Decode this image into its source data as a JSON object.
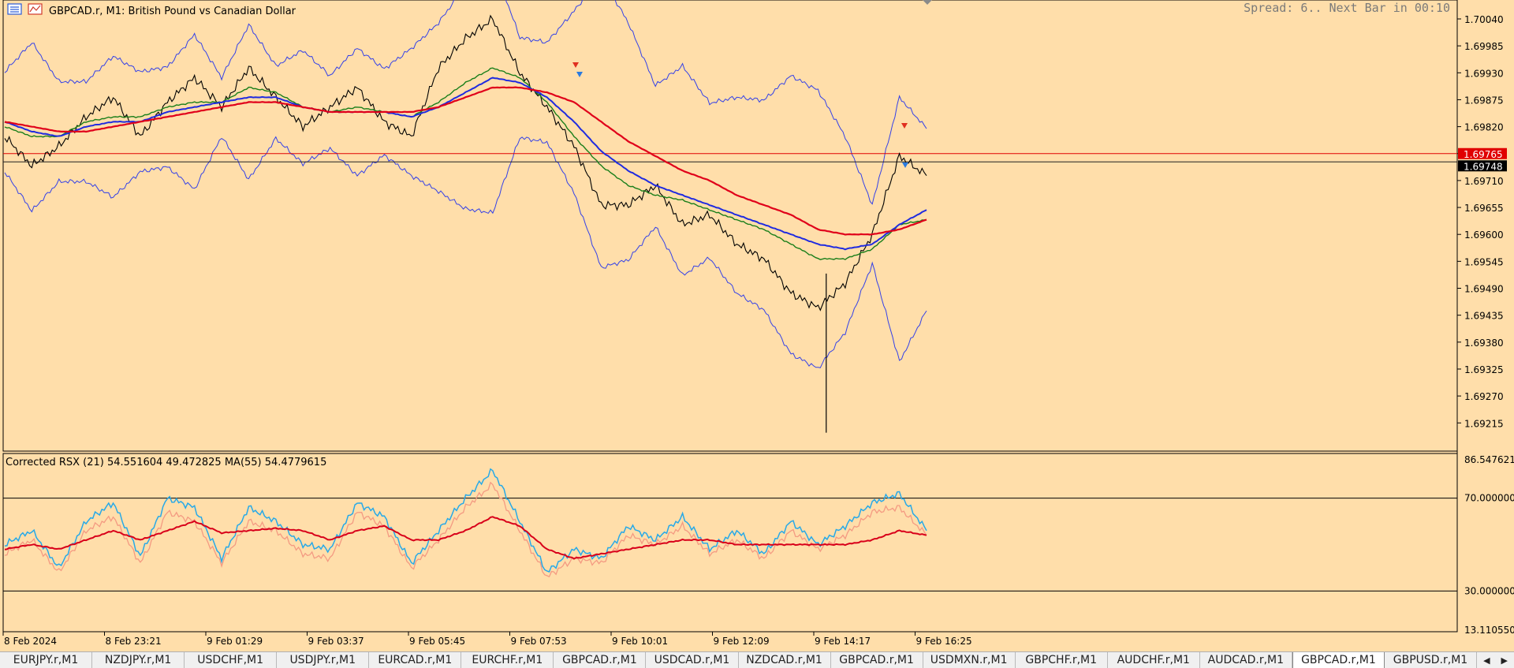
{
  "window": {
    "symbol_title": "GBPCAD.r, M1:  British Pound vs Canadian Dollar",
    "spread_info": "Spread: 6.. Next Bar in 00:10"
  },
  "colors": {
    "background": "#FFDEAA",
    "price": "#000000",
    "ma_red": "#E0001A",
    "ma_blue": "#1F2BE0",
    "ma_green": "#1A7F1A",
    "bands": "#3340E8",
    "rsx_blue": "#27A9E8",
    "rsx_salmon": "#F49A82",
    "rsx_ma_red": "#D8001A"
  },
  "main_chart": {
    "y_ticks": [
      "1.70040",
      "1.69985",
      "1.69930",
      "1.69875",
      "1.69820",
      "1.69765",
      "1.69710",
      "1.69655",
      "1.69600",
      "1.69545",
      "1.69490",
      "1.69435",
      "1.69380",
      "1.69325",
      "1.69270",
      "1.69215"
    ],
    "bid_price_label": "1.69748",
    "ask_price_label": "1.69765",
    "ylim": [
      1.6918,
      1.7006
    ]
  },
  "indicator": {
    "label": "Corrected RSX (21) 54.551604 49.472825 MA(55) 54.4779615",
    "y_ticks": [
      "86.547621",
      "70.000000",
      "30.000000",
      "13.110550"
    ],
    "levels": [
      70,
      30
    ],
    "ylim": [
      13.11055,
      86.547621
    ]
  },
  "x_axis": {
    "labels": [
      "8 Feb 2024",
      "8 Feb 23:21",
      "9 Feb 01:29",
      "9 Feb 03:37",
      "9 Feb 05:45",
      "9 Feb 07:53",
      "9 Feb 10:01",
      "9 Feb 12:09",
      "9 Feb 14:17",
      "9 Feb 16:25"
    ]
  },
  "tabs": [
    {
      "label": "EURJPY.r,M1"
    },
    {
      "label": "NZDJPY.r,M1"
    },
    {
      "label": "USDCHF,M1"
    },
    {
      "label": "USDJPY.r,M1"
    },
    {
      "label": "EURCAD.r,M1"
    },
    {
      "label": "EURCHF.r,M1"
    },
    {
      "label": "GBPCAD.r,M1"
    },
    {
      "label": "USDCAD.r,M1"
    },
    {
      "label": "NZDCAD.r,M1"
    },
    {
      "label": "GBPCAD.r,M1"
    },
    {
      "label": "USDMXN.r,M1"
    },
    {
      "label": "GBPCHF.r,M1"
    },
    {
      "label": "AUDCHF.r,M1"
    },
    {
      "label": "AUDCAD.r,M1"
    },
    {
      "label": "GBPCAD.r,M1",
      "active": true
    },
    {
      "label": "GBPUSD.r,M1"
    }
  ],
  "chart_data": [
    {
      "type": "line",
      "title": "GBPCAD.r, M1:  British Pound vs Canadian Dollar",
      "xlabel": "",
      "ylabel": "",
      "x": [
        "8 Feb 2024",
        "8 Feb 23:21",
        "9 Feb 01:29",
        "9 Feb 03:37",
        "9 Feb 05:45",
        "9 Feb 07:53",
        "9 Feb 10:01",
        "9 Feb 12:09",
        "9 Feb 14:17",
        "9 Feb 16:25"
      ],
      "ylim": [
        1.6918,
        1.7006
      ],
      "series": [
        {
          "name": "",
          "values": [
            1.698,
            1.6974,
            1.6978,
            1.6984,
            1.6988,
            1.698,
            1.6987,
            1.6992,
            1.6986,
            1.6994,
            1.6988,
            1.6982,
            1.6986,
            1.699,
            1.6983,
            1.698,
            1.6994,
            1.7,
            1.7004,
            1.6993,
            1.6986,
            1.6978,
            1.6966,
            1.6966,
            1.697,
            1.6962,
            1.6964,
            1.6958,
            1.6955,
            1.6948,
            1.6945,
            1.695,
            1.696,
            1.6976,
            1.6972
          ]
        },
        {
          "name": "",
          "values": [
            1.6982,
            1.698,
            1.698,
            1.6983,
            1.6984,
            1.6984,
            1.6986,
            1.6987,
            1.6987,
            1.699,
            1.6989,
            1.6986,
            1.6985,
            1.6986,
            1.6985,
            1.6984,
            1.6987,
            1.6991,
            1.6994,
            1.6992,
            1.6987,
            1.698,
            1.6974,
            1.697,
            1.6968,
            1.6967,
            1.6965,
            1.6963,
            1.6961,
            1.6958,
            1.6955,
            1.6955,
            1.6957,
            1.6962,
            1.6963
          ]
        },
        {
          "name": "",
          "values": [
            1.6983,
            1.6981,
            1.698,
            1.6982,
            1.6983,
            1.6983,
            1.6985,
            1.6986,
            1.6987,
            1.6988,
            1.6988,
            1.6986,
            1.6985,
            1.6985,
            1.6985,
            1.6984,
            1.6986,
            1.6989,
            1.6992,
            1.6991,
            1.6988,
            1.6983,
            1.6977,
            1.6973,
            1.697,
            1.6968,
            1.6966,
            1.6964,
            1.6962,
            1.696,
            1.6958,
            1.6957,
            1.6958,
            1.6962,
            1.6965
          ]
        },
        {
          "name": "",
          "values": [
            1.6983,
            1.6982,
            1.6981,
            1.6981,
            1.6982,
            1.6983,
            1.6984,
            1.6985,
            1.6986,
            1.6987,
            1.6987,
            1.6986,
            1.6985,
            1.6985,
            1.6985,
            1.6985,
            1.6986,
            1.6988,
            1.699,
            1.699,
            1.6989,
            1.6987,
            1.6983,
            1.6979,
            1.6976,
            1.6973,
            1.6971,
            1.6968,
            1.6966,
            1.6964,
            1.6961,
            1.696,
            1.696,
            1.6961,
            1.6963
          ]
        }
      ]
    },
    {
      "type": "line",
      "title": "Corrected RSX (21) 54.551604 49.472825 MA(55) 54.4779615",
      "ylim": [
        13.11055,
        86.547621
      ],
      "series": [
        {
          "name": "",
          "values": [
            50,
            56,
            40,
            60,
            68,
            45,
            70,
            66,
            44,
            66,
            60,
            50,
            48,
            68,
            62,
            42,
            56,
            70,
            82,
            60,
            38,
            48,
            44,
            58,
            52,
            62,
            48,
            56,
            46,
            60,
            50,
            58,
            68,
            72,
            56
          ]
        },
        {
          "name": "",
          "values": [
            46,
            52,
            38,
            56,
            62,
            42,
            64,
            60,
            42,
            60,
            56,
            46,
            44,
            64,
            58,
            40,
            52,
            66,
            76,
            56,
            36,
            44,
            42,
            54,
            50,
            58,
            46,
            52,
            44,
            56,
            48,
            54,
            64,
            66,
            54
          ]
        },
        {
          "name": "",
          "values": [
            48,
            50,
            48,
            52,
            56,
            52,
            56,
            60,
            55,
            56,
            57,
            56,
            52,
            56,
            58,
            52,
            52,
            56,
            62,
            58,
            48,
            44,
            46,
            48,
            50,
            52,
            52,
            50,
            50,
            50,
            50,
            50,
            52,
            56,
            54
          ]
        }
      ]
    }
  ]
}
